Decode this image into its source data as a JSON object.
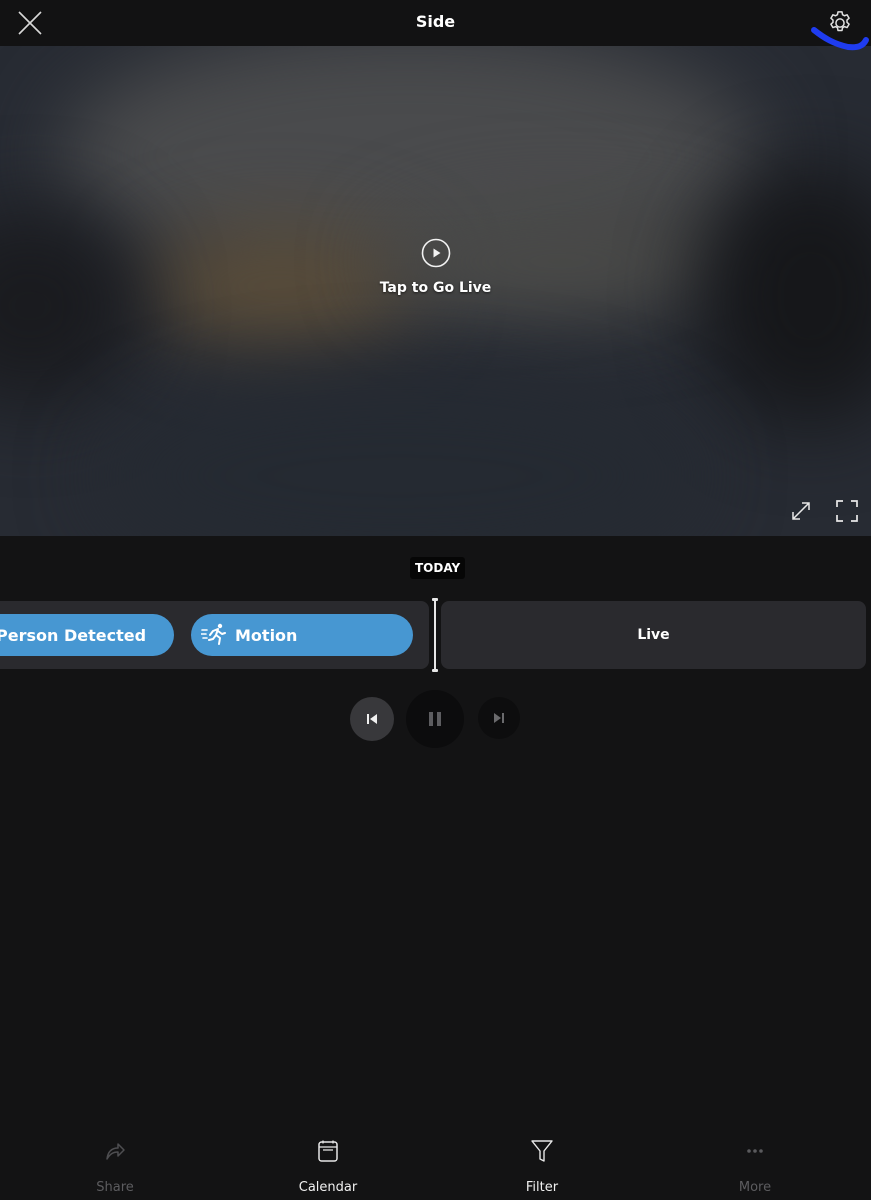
{
  "header": {
    "title": "Side",
    "close_icon": "close-icon",
    "settings_icon": "gear-icon"
  },
  "video": {
    "play_icon": "play-circle-icon",
    "go_live_text": "Tap to Go Live",
    "expand_icon": "expand-arrows-icon",
    "fullscreen_icon": "fullscreen-icon"
  },
  "timeline": {
    "date_badge": "TODAY",
    "events": [
      {
        "label": "Person Detected",
        "type": "person"
      },
      {
        "label": "Motion",
        "type": "motion",
        "icon": "running-person-icon"
      }
    ],
    "live_label": "Live",
    "event_color": "#4797d2"
  },
  "playback": {
    "previous_icon": "skip-previous-icon",
    "pause_icon": "pause-icon",
    "next_icon": "skip-next-icon"
  },
  "bottom_bar": {
    "items": [
      {
        "label": "Share",
        "icon": "share-icon",
        "enabled": false
      },
      {
        "label": "Calendar",
        "icon": "calendar-icon",
        "enabled": true
      },
      {
        "label": "Filter",
        "icon": "filter-icon",
        "enabled": true
      },
      {
        "label": "More",
        "icon": "more-dots-icon",
        "enabled": false
      }
    ]
  },
  "annotation": {
    "color": "#1f3cf0"
  }
}
